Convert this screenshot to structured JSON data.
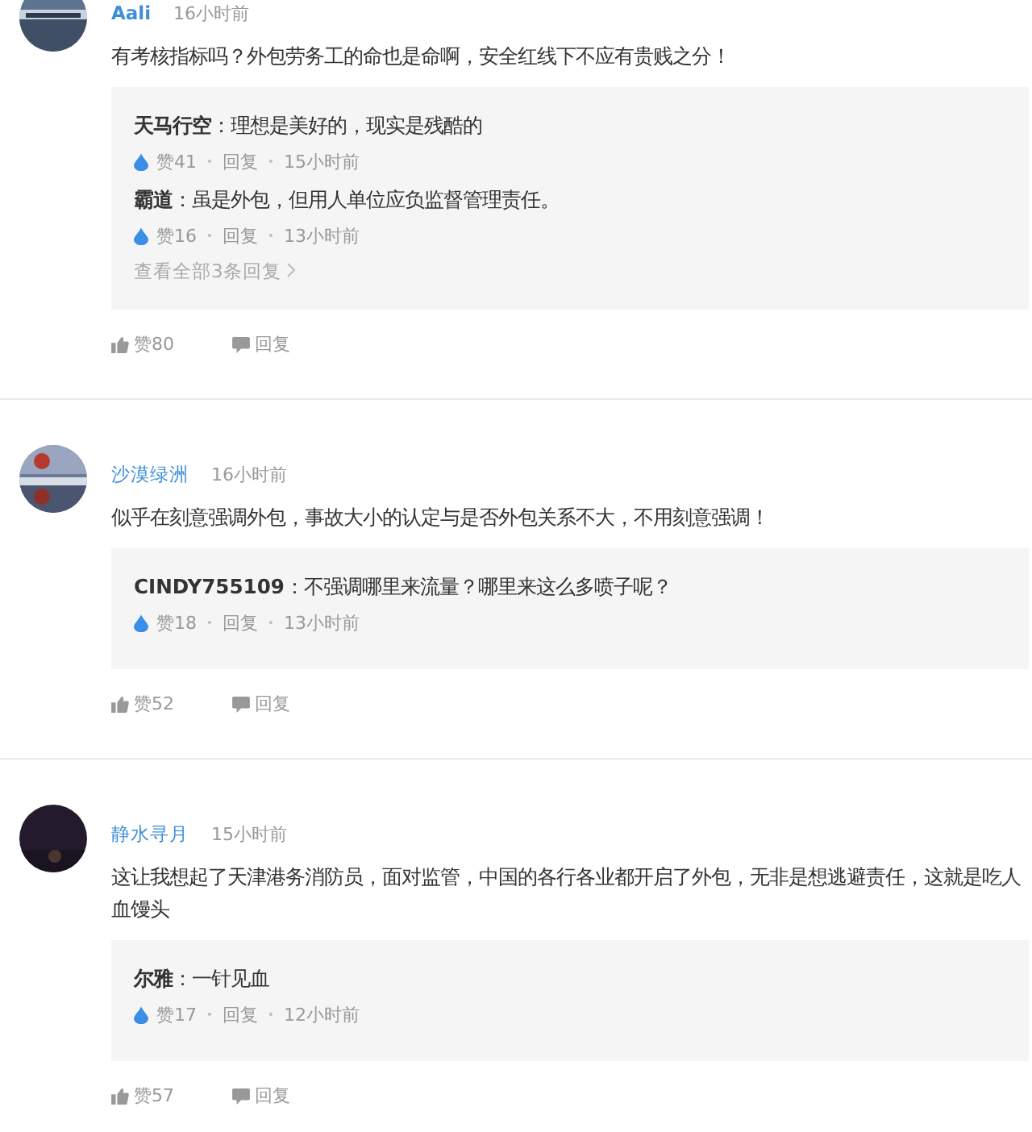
{
  "comments": [
    {
      "user": "Aali",
      "time": "16小时前",
      "text": "有考核指标吗？外包劳务工的命也是命啊，安全红线下不应有贵贱之分！",
      "replies": [
        {
          "text": "**天马行空**：理想是美好的，现实是残酷的",
          "likes": "赞41",
          "reply": "回复",
          "time": "15小时前"
        },
        {
          "text": "**霸道**：虽是外包，但用人单位应负监督管理责任。",
          "likes": "赞16",
          "reply": "回复",
          "time": "13小时前"
        }
      ],
      "more": "查看全部3条回复",
      "likes": "赞80",
      "reply": "回复"
    },
    {
      "user": "沙漠绿洲",
      "time": "16小时前",
      "text": "似乎在刻意强调外包，事故大小的认定与是否外包关系不大，不用刻意强调！",
      "replies": [
        {
          "text": "**CINDY755109**：不强调哪里来流量？哪里来这么多喷子呢？",
          "likes": "赞18",
          "reply": "回复",
          "time": "13小时前"
        }
      ],
      "likes": "赞52",
      "reply": "回复"
    },
    {
      "user": "静水寻月",
      "time": "15小时前",
      "text": "这让我想起了天津港务消防员，面对监管，中国的各行各业都开启了外包，无非是想逃避责任，这就是吃人血馒头",
      "replies": [
        {
          "text": "**尔雅**：一针见血",
          "likes": "赞17",
          "reply": "回复",
          "time": "12小时前"
        }
      ],
      "likes": "赞57",
      "reply": "回复"
    }
  ]
}
